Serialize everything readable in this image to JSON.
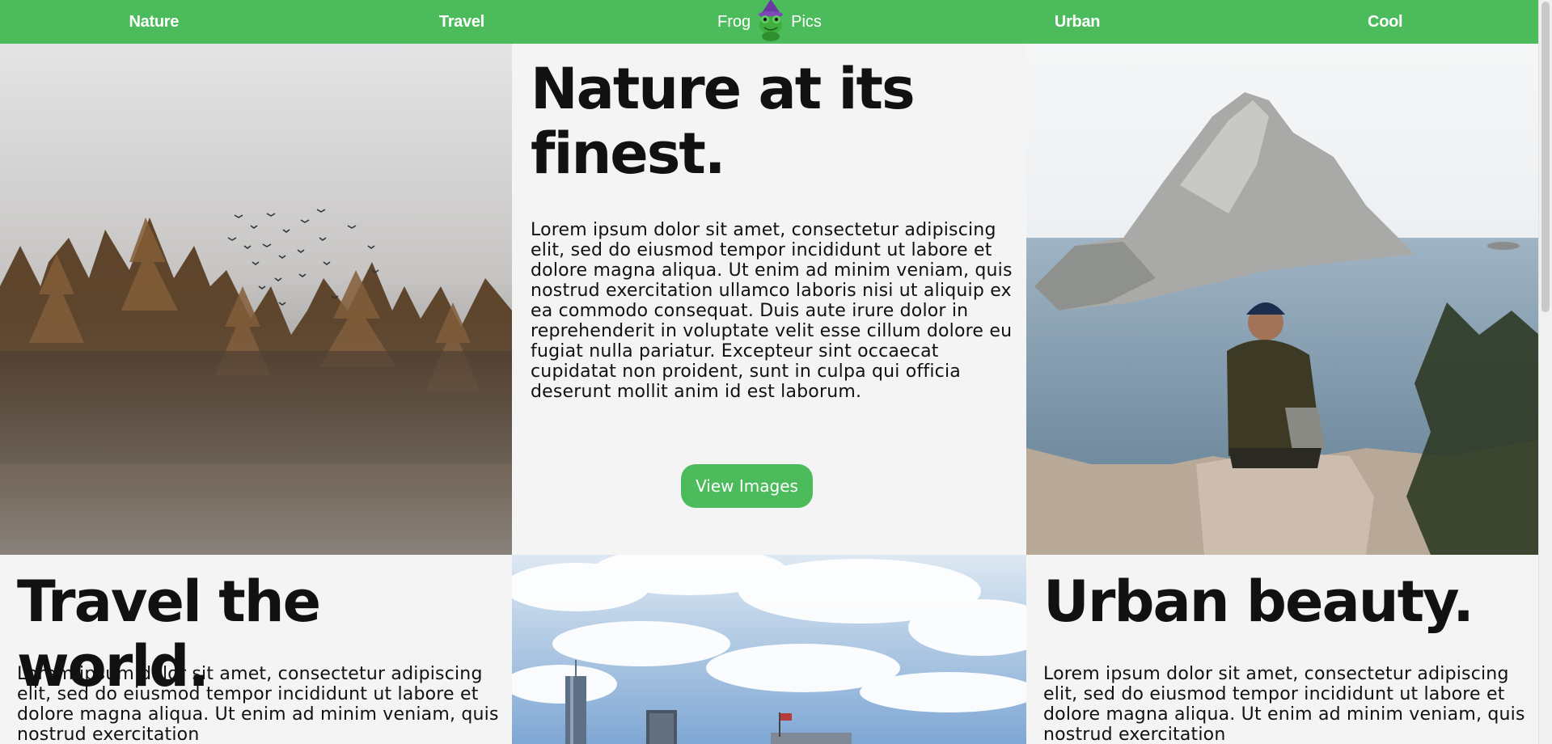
{
  "nav": {
    "items": [
      "Nature",
      "Travel",
      "Urban",
      "Cool"
    ],
    "brand_left": "Frog",
    "brand_right": "Pics",
    "logo_icon": "frog-wizard-icon"
  },
  "sections": {
    "nature": {
      "title": "Nature at its finest.",
      "body": "Lorem ipsum dolor sit amet, consectetur adipiscing elit, sed do eiusmod tempor incididunt ut labore et dolore magna aliqua. Ut enim ad minim veniam, quis nostrud exercitation ullamco laboris nisi ut aliquip ex ea commodo consequat. Duis aute irure dolor in reprehenderit in voluptate velit esse cillum dolore eu fugiat nulla pariatur. Excepteur sint occaecat cupidatat non proident, sunt in culpa qui officia deserunt mollit anim id est laborum.",
      "button": "View Images"
    },
    "travel": {
      "title": "Travel the world.",
      "body": "Lorem ipsum dolor sit amet, consectetur adipiscing elit, sed do eiusmod tempor incididunt ut labore et dolore magna aliqua. Ut enim ad minim veniam, quis nostrud exercitation"
    },
    "urban": {
      "title": "Urban beauty.",
      "body": "Lorem ipsum dolor sit amet, consectetur adipiscing elit, sed do eiusmod tempor incididunt ut labore et dolore magna aliqua. Ut enim ad minim veniam, quis nostrud exercitation"
    }
  },
  "colors": {
    "accent": "#4cbb5b",
    "page_bg": "#f4f4f4",
    "text": "#111111"
  }
}
